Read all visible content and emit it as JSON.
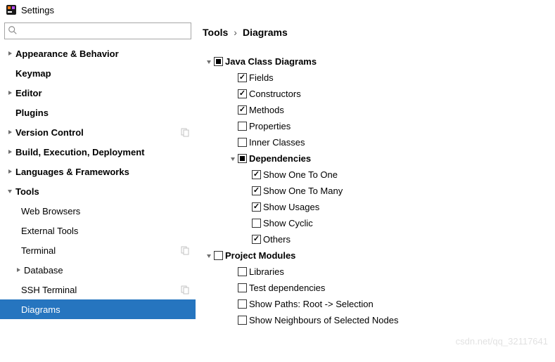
{
  "window": {
    "title": "Settings"
  },
  "search": {
    "placeholder": ""
  },
  "sidebar": {
    "items": [
      {
        "label": "Appearance & Behavior",
        "bold": true,
        "expandable": true,
        "expanded": false,
        "indent": 0
      },
      {
        "label": "Keymap",
        "bold": true,
        "expandable": false,
        "indent": 0
      },
      {
        "label": "Editor",
        "bold": true,
        "expandable": true,
        "expanded": false,
        "indent": 0
      },
      {
        "label": "Plugins",
        "bold": true,
        "expandable": false,
        "indent": 0
      },
      {
        "label": "Version Control",
        "bold": true,
        "expandable": true,
        "expanded": false,
        "indent": 0,
        "copyIcon": true
      },
      {
        "label": "Build, Execution, Deployment",
        "bold": true,
        "expandable": true,
        "expanded": false,
        "indent": 0
      },
      {
        "label": "Languages & Frameworks",
        "bold": true,
        "expandable": true,
        "expanded": false,
        "indent": 0
      },
      {
        "label": "Tools",
        "bold": true,
        "expandable": true,
        "expanded": true,
        "indent": 0
      },
      {
        "label": "Web Browsers",
        "bold": false,
        "expandable": false,
        "indent": 1
      },
      {
        "label": "External Tools",
        "bold": false,
        "expandable": false,
        "indent": 1
      },
      {
        "label": "Terminal",
        "bold": false,
        "expandable": false,
        "indent": 1,
        "copyIcon": true
      },
      {
        "label": "Database",
        "bold": false,
        "expandable": true,
        "expanded": false,
        "indent": 1
      },
      {
        "label": "SSH Terminal",
        "bold": false,
        "expandable": false,
        "indent": 1,
        "copyIcon": true
      },
      {
        "label": "Diagrams",
        "bold": false,
        "expandable": false,
        "indent": 1,
        "selected": true
      }
    ]
  },
  "breadcrumb": {
    "parts": [
      "Tools",
      "Diagrams"
    ]
  },
  "settings": {
    "rows": [
      {
        "label": "Java Class Diagrams",
        "bold": true,
        "indent": 0,
        "expandable": true,
        "expanded": true,
        "check": "partial"
      },
      {
        "label": "Fields",
        "indent": 1,
        "check": "checked"
      },
      {
        "label": "Constructors",
        "indent": 1,
        "check": "checked"
      },
      {
        "label": "Methods",
        "indent": 1,
        "check": "checked"
      },
      {
        "label": "Properties",
        "indent": 1,
        "check": "unchecked"
      },
      {
        "label": "Inner Classes",
        "indent": 1,
        "check": "unchecked"
      },
      {
        "label": "Dependencies",
        "bold": true,
        "indent": 1,
        "expandable": true,
        "expanded": true,
        "check": "partial"
      },
      {
        "label": "Show One To One",
        "indent": 2,
        "check": "checked"
      },
      {
        "label": "Show One To Many",
        "indent": 2,
        "check": "checked"
      },
      {
        "label": "Show Usages",
        "indent": 2,
        "check": "checked"
      },
      {
        "label": "Show Cyclic",
        "indent": 2,
        "check": "unchecked"
      },
      {
        "label": "Others",
        "indent": 2,
        "check": "checked"
      },
      {
        "label": "Project Modules",
        "bold": true,
        "indent": 0,
        "expandable": true,
        "expanded": true,
        "check": "unchecked"
      },
      {
        "label": "Libraries",
        "indent": 1,
        "check": "unchecked"
      },
      {
        "label": "Test dependencies",
        "indent": 1,
        "check": "unchecked"
      },
      {
        "label": "Show Paths: Root -> Selection",
        "indent": 1,
        "check": "unchecked"
      },
      {
        "label": "Show Neighbours of Selected Nodes",
        "indent": 1,
        "check": "unchecked"
      }
    ]
  },
  "watermark": "csdn.net/qq_32117641"
}
